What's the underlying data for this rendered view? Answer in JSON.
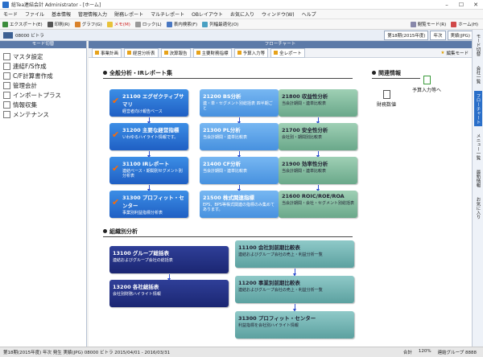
{
  "window": {
    "title": "総Tea連結会計 Administrator - [ホーム]"
  },
  "menu": [
    "モード",
    "ファイル",
    "基本情報",
    "管理情報入力",
    "財務レポート",
    "マルチレポート",
    "OBレイアウト",
    "お気に入り",
    "ウィンドウ(W)",
    "ヘルプ"
  ],
  "toolbar": {
    "items": [
      "エクスポート(E)",
      "印刷(R)",
      "グラフ(G)",
      "メモ(M)",
      "ロック(L)",
      "表内検索(F)",
      "列幅最適化(O)"
    ],
    "right": [
      "閲覧モード(R)",
      "ホーム(H)"
    ]
  },
  "subbar": {
    "db": "08000 ビトラ",
    "period": [
      "第18期(2015年度)",
      "年次",
      "実績(JPG)"
    ]
  },
  "sidebar": {
    "header": "モード切替",
    "items": [
      "マスタ設定",
      "連結F/S作成",
      "C/F計算書作成",
      "管理会計",
      "インポートプラス",
      "情報収集",
      "メンテナンス"
    ]
  },
  "main": {
    "header": "フローチャート",
    "tabs": [
      "事業計画",
      "経営分析表",
      "決算報告",
      "主要財務指標",
      "予算入力等",
      "全レポート"
    ],
    "edit_mode": "編集モード"
  },
  "sections": {
    "overall": "全般分析・IRレポート集",
    "related": "関連情報",
    "org": "組織別分析"
  },
  "related_items": {
    "budget": "予算入力等へ",
    "financial": "財務数値"
  },
  "cards": {
    "c21100": {
      "title": "21100 エグゼクティブサマリ",
      "sub": "経営者向け報告ベース"
    },
    "c31200": {
      "title": "31200 主要な経営指標",
      "sub": "いわゆるハイライト情報です。"
    },
    "c31100": {
      "title": "31100 IRレポート",
      "sub": "連結ベース・期間別セグメント別分析表"
    },
    "c31300": {
      "title": "31300 プロフィット・センター",
      "sub": "事業別利益指標分析表"
    },
    "c21200": {
      "title": "21200 BS分析",
      "sub": "連・単・セグメント別総括表 四半期ごと"
    },
    "c21300": {
      "title": "21300 PL分析",
      "sub": "当会計期間・連単比較表"
    },
    "c21400": {
      "title": "21400 CF分析",
      "sub": "当会計期間・連単比較表"
    },
    "c21500": {
      "title": "21500 株式関連指標",
      "sub": "EPS、BPS等株式関連の指標のみ集めてあります。"
    },
    "c21800": {
      "title": "21800 収益性分析",
      "sub": "当会計期間・連単比較表"
    },
    "c21700": {
      "title": "21700 安全性分析",
      "sub": "会社別・期間別比較表"
    },
    "c21900": {
      "title": "21900 効率性分析",
      "sub": "当会計期間・連単比較表"
    },
    "c21600": {
      "title": "21600 ROIC/ROE/ROA",
      "sub": "当会計期間・会社・セグメント別総括表"
    },
    "c13100": {
      "title": "13100 グループ総括表",
      "sub": "連結およびグループ会社の総括表"
    },
    "c13200": {
      "title": "13200 各社総括表",
      "sub": "会社別財務ハイライト情報"
    },
    "c11100": {
      "title": "11100 会社別前期比較表",
      "sub": "連結およびグループ会社の売上・利益分析一覧"
    },
    "c11200": {
      "title": "11200 事業別前期比較表",
      "sub": "連結およびグループ会社の売上・利益分析一覧"
    },
    "c31300b": {
      "title": "31300 プロフィット・センター",
      "sub": "利益指標を会社別ハイライト情報"
    }
  },
  "rightbar": [
    "モード切替",
    "会社一覧",
    "フローチャート",
    "メニュー一覧",
    "最新情報",
    "お気に入り"
  ],
  "statusbar": {
    "left": "第18期(2015年度) 年次 発生 実績(JPG) 08000 ビトラ 2015/04/01 - 2016/03/31",
    "right": [
      "合計",
      "120%",
      "連結グループ 8888"
    ]
  }
}
